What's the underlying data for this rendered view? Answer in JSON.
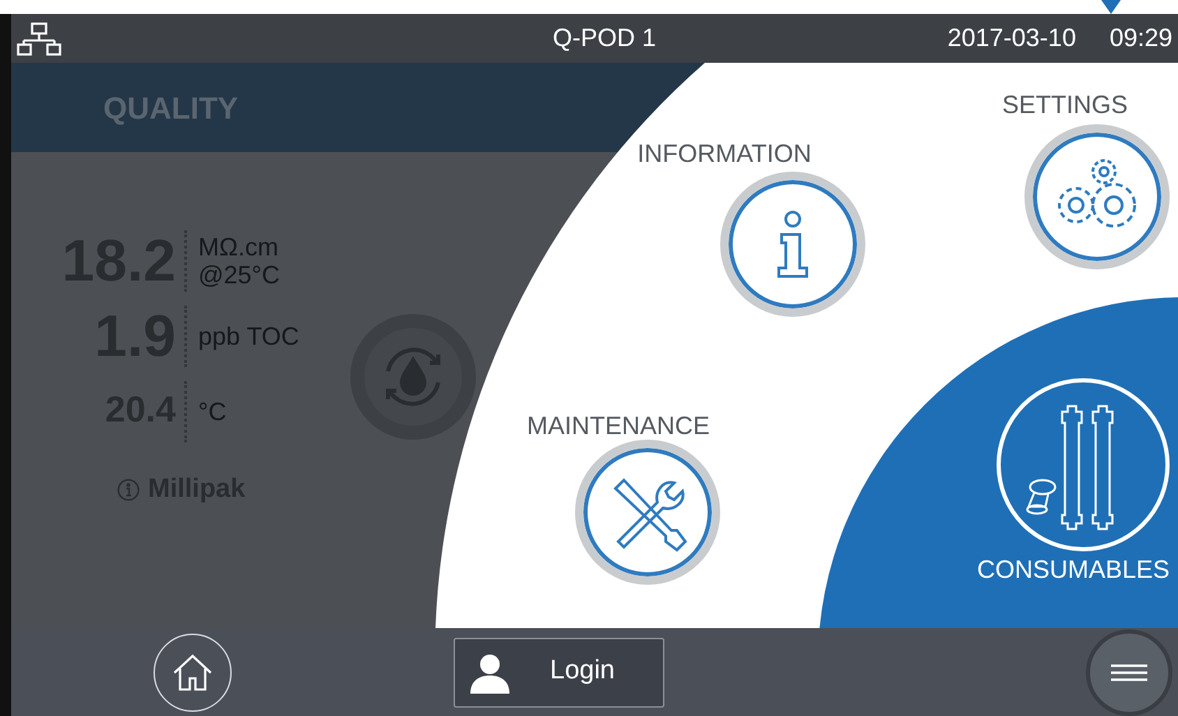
{
  "header": {
    "title": "Q-POD 1",
    "date": "2017-03-10",
    "time": "09:29"
  },
  "quality": {
    "title": "QUALITY",
    "readings": [
      {
        "value": "18.2",
        "unit": [
          "MΩ.cm",
          "@25°C"
        ],
        "kind": "primary"
      },
      {
        "value": "1.9",
        "unit": [
          "ppb TOC"
        ],
        "kind": "primary"
      },
      {
        "value": "20.4",
        "unit": [
          "°C"
        ],
        "kind": "secondary"
      }
    ],
    "polisher": "Millipak"
  },
  "menu": [
    {
      "kind": "information",
      "label": "INFORMATION",
      "selected": false
    },
    {
      "kind": "settings",
      "label": "SETTINGS",
      "selected": false
    },
    {
      "kind": "maintenance",
      "label": "MAINTENANCE",
      "selected": false
    },
    {
      "kind": "consumables",
      "label": "CONSUMABLES",
      "selected": true
    }
  ],
  "bottom": {
    "login": "Login"
  }
}
